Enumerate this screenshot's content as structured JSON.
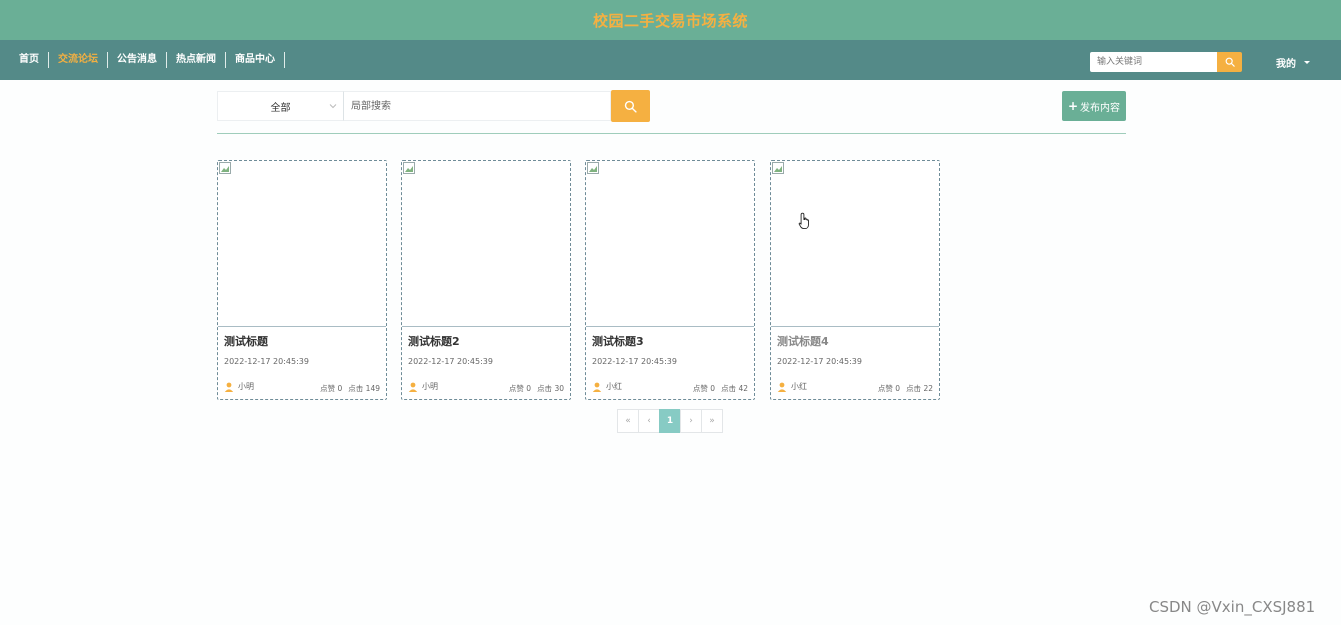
{
  "header": {
    "title": "校园二手交易市场系统"
  },
  "nav": {
    "items": [
      {
        "label": "首页"
      },
      {
        "label": "交流论坛"
      },
      {
        "label": "公告消息"
      },
      {
        "label": "热点新闻"
      },
      {
        "label": "商品中心"
      }
    ],
    "active_index": 1
  },
  "top_search": {
    "placeholder": "输入关键词"
  },
  "user_menu": {
    "label": "我的"
  },
  "filter": {
    "select_value": "全部",
    "search_placeholder": "局部搜索",
    "publish_label": "发布内容"
  },
  "posts": [
    {
      "title": "测试标题",
      "date": "2022-12-17 20:45:39",
      "author": "小明",
      "likes": "点赞 0",
      "clicks": "点击 149"
    },
    {
      "title": "测试标题2",
      "date": "2022-12-17 20:45:39",
      "author": "小明",
      "likes": "点赞 0",
      "clicks": "点击 30"
    },
    {
      "title": "测试标题3",
      "date": "2022-12-17 20:45:39",
      "author": "小红",
      "likes": "点赞 0",
      "clicks": "点击 42"
    },
    {
      "title": "测试标题4",
      "date": "2022-12-17 20:45:39",
      "author": "小红",
      "likes": "点赞 0",
      "clicks": "点击 22"
    }
  ],
  "pagination": {
    "first": "«",
    "prev": "‹",
    "current": "1",
    "next": "›",
    "last": "»"
  },
  "watermark": "CSDN @Vxin_CXSJ881",
  "colors": {
    "title_bar": "#6aaf96",
    "nav_bar": "#548a88",
    "accent": "#f5b041",
    "page_active": "#87cbc4"
  }
}
